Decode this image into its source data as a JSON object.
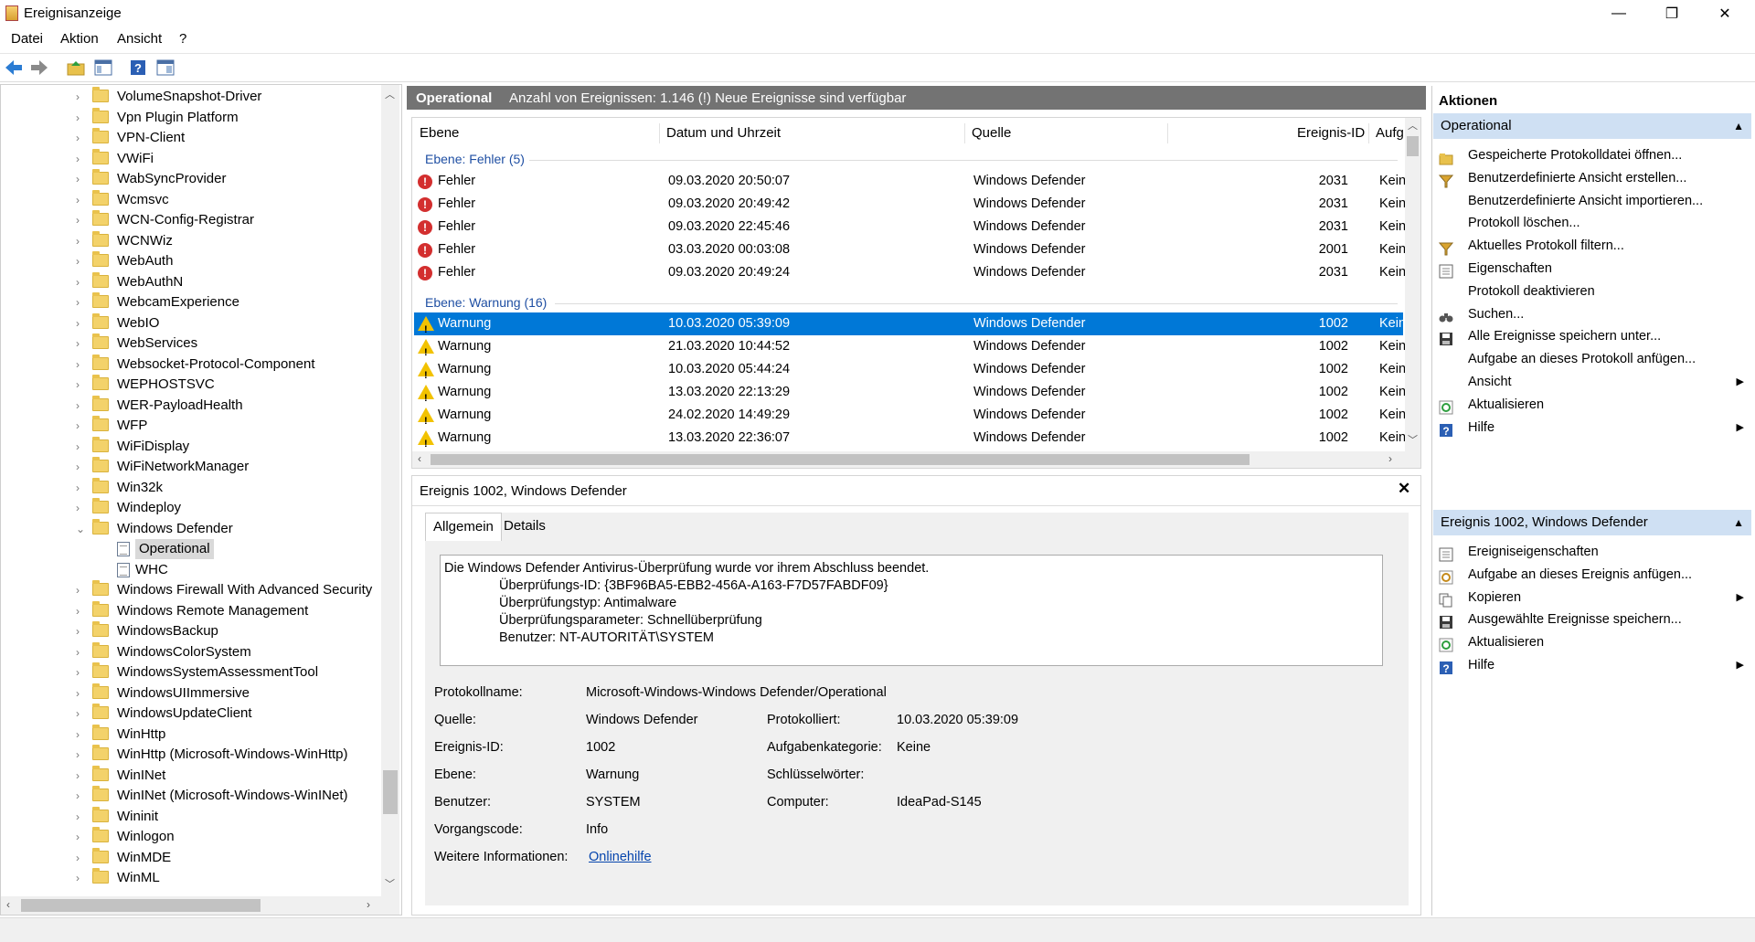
{
  "window": {
    "title": "Ereignisanzeige",
    "min": "—",
    "max": "❐",
    "close": "✕"
  },
  "menu": [
    "Datei",
    "Aktion",
    "Ansicht",
    "?"
  ],
  "tree": {
    "items": [
      {
        "label": "VolumeSnapshot-Driver",
        "type": "folder"
      },
      {
        "label": "Vpn Plugin Platform",
        "type": "folder"
      },
      {
        "label": "VPN-Client",
        "type": "folder"
      },
      {
        "label": "VWiFi",
        "type": "folder"
      },
      {
        "label": "WabSyncProvider",
        "type": "folder"
      },
      {
        "label": "Wcmsvc",
        "type": "folder"
      },
      {
        "label": "WCN-Config-Registrar",
        "type": "folder"
      },
      {
        "label": "WCNWiz",
        "type": "folder"
      },
      {
        "label": "WebAuth",
        "type": "folder"
      },
      {
        "label": "WebAuthN",
        "type": "folder"
      },
      {
        "label": "WebcamExperience",
        "type": "folder"
      },
      {
        "label": "WebIO",
        "type": "folder"
      },
      {
        "label": "WebServices",
        "type": "folder"
      },
      {
        "label": "Websocket-Protocol-Component",
        "type": "folder"
      },
      {
        "label": "WEPHOSTSVC",
        "type": "folder"
      },
      {
        "label": "WER-PayloadHealth",
        "type": "folder"
      },
      {
        "label": "WFP",
        "type": "folder"
      },
      {
        "label": "WiFiDisplay",
        "type": "folder"
      },
      {
        "label": "WiFiNetworkManager",
        "type": "folder"
      },
      {
        "label": "Win32k",
        "type": "folder"
      },
      {
        "label": "Windeploy",
        "type": "folder"
      },
      {
        "label": "Windows Defender",
        "type": "folder-open"
      },
      {
        "label": "Operational",
        "type": "log",
        "selected": true
      },
      {
        "label": "WHC",
        "type": "log"
      },
      {
        "label": "Windows Firewall With Advanced Security",
        "type": "folder"
      },
      {
        "label": "Windows Remote Management",
        "type": "folder"
      },
      {
        "label": "WindowsBackup",
        "type": "folder"
      },
      {
        "label": "WindowsColorSystem",
        "type": "folder"
      },
      {
        "label": "WindowsSystemAssessmentTool",
        "type": "folder"
      },
      {
        "label": "WindowsUIImmersive",
        "type": "folder"
      },
      {
        "label": "WindowsUpdateClient",
        "type": "folder"
      },
      {
        "label": "WinHttp",
        "type": "folder"
      },
      {
        "label": "WinHttp (Microsoft-Windows-WinHttp)",
        "type": "folder"
      },
      {
        "label": "WinINet",
        "type": "folder"
      },
      {
        "label": "WinINet (Microsoft-Windows-WinINet)",
        "type": "folder"
      },
      {
        "label": "Wininit",
        "type": "folder"
      },
      {
        "label": "Winlogon",
        "type": "folder"
      },
      {
        "label": "WinMDE",
        "type": "folder"
      },
      {
        "label": "WinML",
        "type": "folder"
      }
    ]
  },
  "center": {
    "log_name": "Operational",
    "summary": "Anzahl von Ereignissen: 1.146 (!) Neue Ereignisse sind verfügbar",
    "columns": [
      "Ebene",
      "Datum und Uhrzeit",
      "Quelle",
      "Ereignis-ID",
      "Aufg"
    ],
    "group_error": "Ebene: Fehler (5)",
    "group_warning": "Ebene: Warnung (16)",
    "errors": [
      {
        "level": "Fehler",
        "date": "09.03.2020 20:50:07",
        "source": "Windows Defender",
        "id": "2031",
        "task": "Kein"
      },
      {
        "level": "Fehler",
        "date": "09.03.2020 20:49:42",
        "source": "Windows Defender",
        "id": "2031",
        "task": "Kein"
      },
      {
        "level": "Fehler",
        "date": "09.03.2020 22:45:46",
        "source": "Windows Defender",
        "id": "2031",
        "task": "Kein"
      },
      {
        "level": "Fehler",
        "date": "03.03.2020 00:03:08",
        "source": "Windows Defender",
        "id": "2001",
        "task": "Kein"
      },
      {
        "level": "Fehler",
        "date": "09.03.2020 20:49:24",
        "source": "Windows Defender",
        "id": "2031",
        "task": "Kein"
      }
    ],
    "warnings": [
      {
        "level": "Warnung",
        "date": "10.03.2020 05:39:09",
        "source": "Windows Defender",
        "id": "1002",
        "task": "Kein",
        "selected": true
      },
      {
        "level": "Warnung",
        "date": "21.03.2020 10:44:52",
        "source": "Windows Defender",
        "id": "1002",
        "task": "Kein"
      },
      {
        "level": "Warnung",
        "date": "10.03.2020 05:44:24",
        "source": "Windows Defender",
        "id": "1002",
        "task": "Kein"
      },
      {
        "level": "Warnung",
        "date": "13.03.2020 22:13:29",
        "source": "Windows Defender",
        "id": "1002",
        "task": "Kein"
      },
      {
        "level": "Warnung",
        "date": "24.02.2020 14:49:29",
        "source": "Windows Defender",
        "id": "1002",
        "task": "Kein"
      },
      {
        "level": "Warnung",
        "date": "13.03.2020 22:36:07",
        "source": "Windows Defender",
        "id": "1002",
        "task": "Kein"
      }
    ]
  },
  "detail": {
    "title": "Ereignis 1002, Windows Defender",
    "tabs": [
      "Allgemein",
      "Details"
    ],
    "message": [
      "Die Windows Defender Antivirus-Überprüfung wurde vor ihrem Abschluss beendet.",
      "Überprüfungs-ID: {3BF96BA5-EBB2-456A-A163-F7D57FABDF09}",
      "Überprüfungstyp: Antimalware",
      "Überprüfungsparameter: Schnellüberprüfung",
      "Benutzer: NT-AUTORITÄT\\SYSTEM"
    ],
    "fields": {
      "protokollname_label": "Protokollname:",
      "protokollname": "Microsoft-Windows-Windows Defender/Operational",
      "quelle_label": "Quelle:",
      "quelle": "Windows Defender",
      "protokolliert_label": "Protokolliert:",
      "protokolliert": "10.03.2020 05:39:09",
      "ereignisid_label": "Ereignis-ID:",
      "ereignisid": "1002",
      "aufgabenkategorie_label": "Aufgabenkategorie:",
      "aufgabenkategorie": "Keine",
      "ebene_label": "Ebene:",
      "ebene": "Warnung",
      "schluessel_label": "Schlüsselwörter:",
      "benutzer_label": "Benutzer:",
      "benutzer": "SYSTEM",
      "computer_label": "Computer:",
      "computer": "IdeaPad-S145",
      "vorgang_label": "Vorgangscode:",
      "vorgang": "Info",
      "weitere_label": "Weitere Informationen:",
      "weitere_link": "Onlinehilfe"
    }
  },
  "actions": {
    "title": "Aktionen",
    "section1": "Operational",
    "items1": [
      {
        "label": "Gespeicherte Protokolldatei öffnen...",
        "icon": "open-folder-icon"
      },
      {
        "label": "Benutzerdefinierte Ansicht erstellen...",
        "icon": "filter-icon"
      },
      {
        "label": "Benutzerdefinierte Ansicht importieren...",
        "icon": ""
      },
      {
        "label": "Protokoll löschen...",
        "icon": ""
      },
      {
        "label": "Aktuelles Protokoll filtern...",
        "icon": "filter-icon"
      },
      {
        "label": "Eigenschaften",
        "icon": "properties-icon"
      },
      {
        "label": "Protokoll deaktivieren",
        "icon": ""
      },
      {
        "label": "Suchen...",
        "icon": "binoculars-icon"
      },
      {
        "label": "Alle Ereignisse speichern unter...",
        "icon": "save-icon"
      },
      {
        "label": "Aufgabe an dieses Protokoll anfügen...",
        "icon": ""
      },
      {
        "label": "Ansicht",
        "icon": "",
        "submenu": true
      },
      {
        "label": "Aktualisieren",
        "icon": "refresh-icon"
      },
      {
        "label": "Hilfe",
        "icon": "help-icon",
        "submenu": true
      }
    ],
    "section2": "Ereignis 1002, Windows Defender",
    "items2": [
      {
        "label": "Ereigniseigenschaften",
        "icon": "properties-icon"
      },
      {
        "label": "Aufgabe an dieses Ereignis anfügen...",
        "icon": "task-icon"
      },
      {
        "label": "Kopieren",
        "icon": "copy-icon",
        "submenu": true
      },
      {
        "label": "Ausgewählte Ereignisse speichern...",
        "icon": "save-icon"
      },
      {
        "label": "Aktualisieren",
        "icon": "refresh-icon"
      },
      {
        "label": "Hilfe",
        "icon": "help-icon",
        "submenu": true
      }
    ]
  }
}
